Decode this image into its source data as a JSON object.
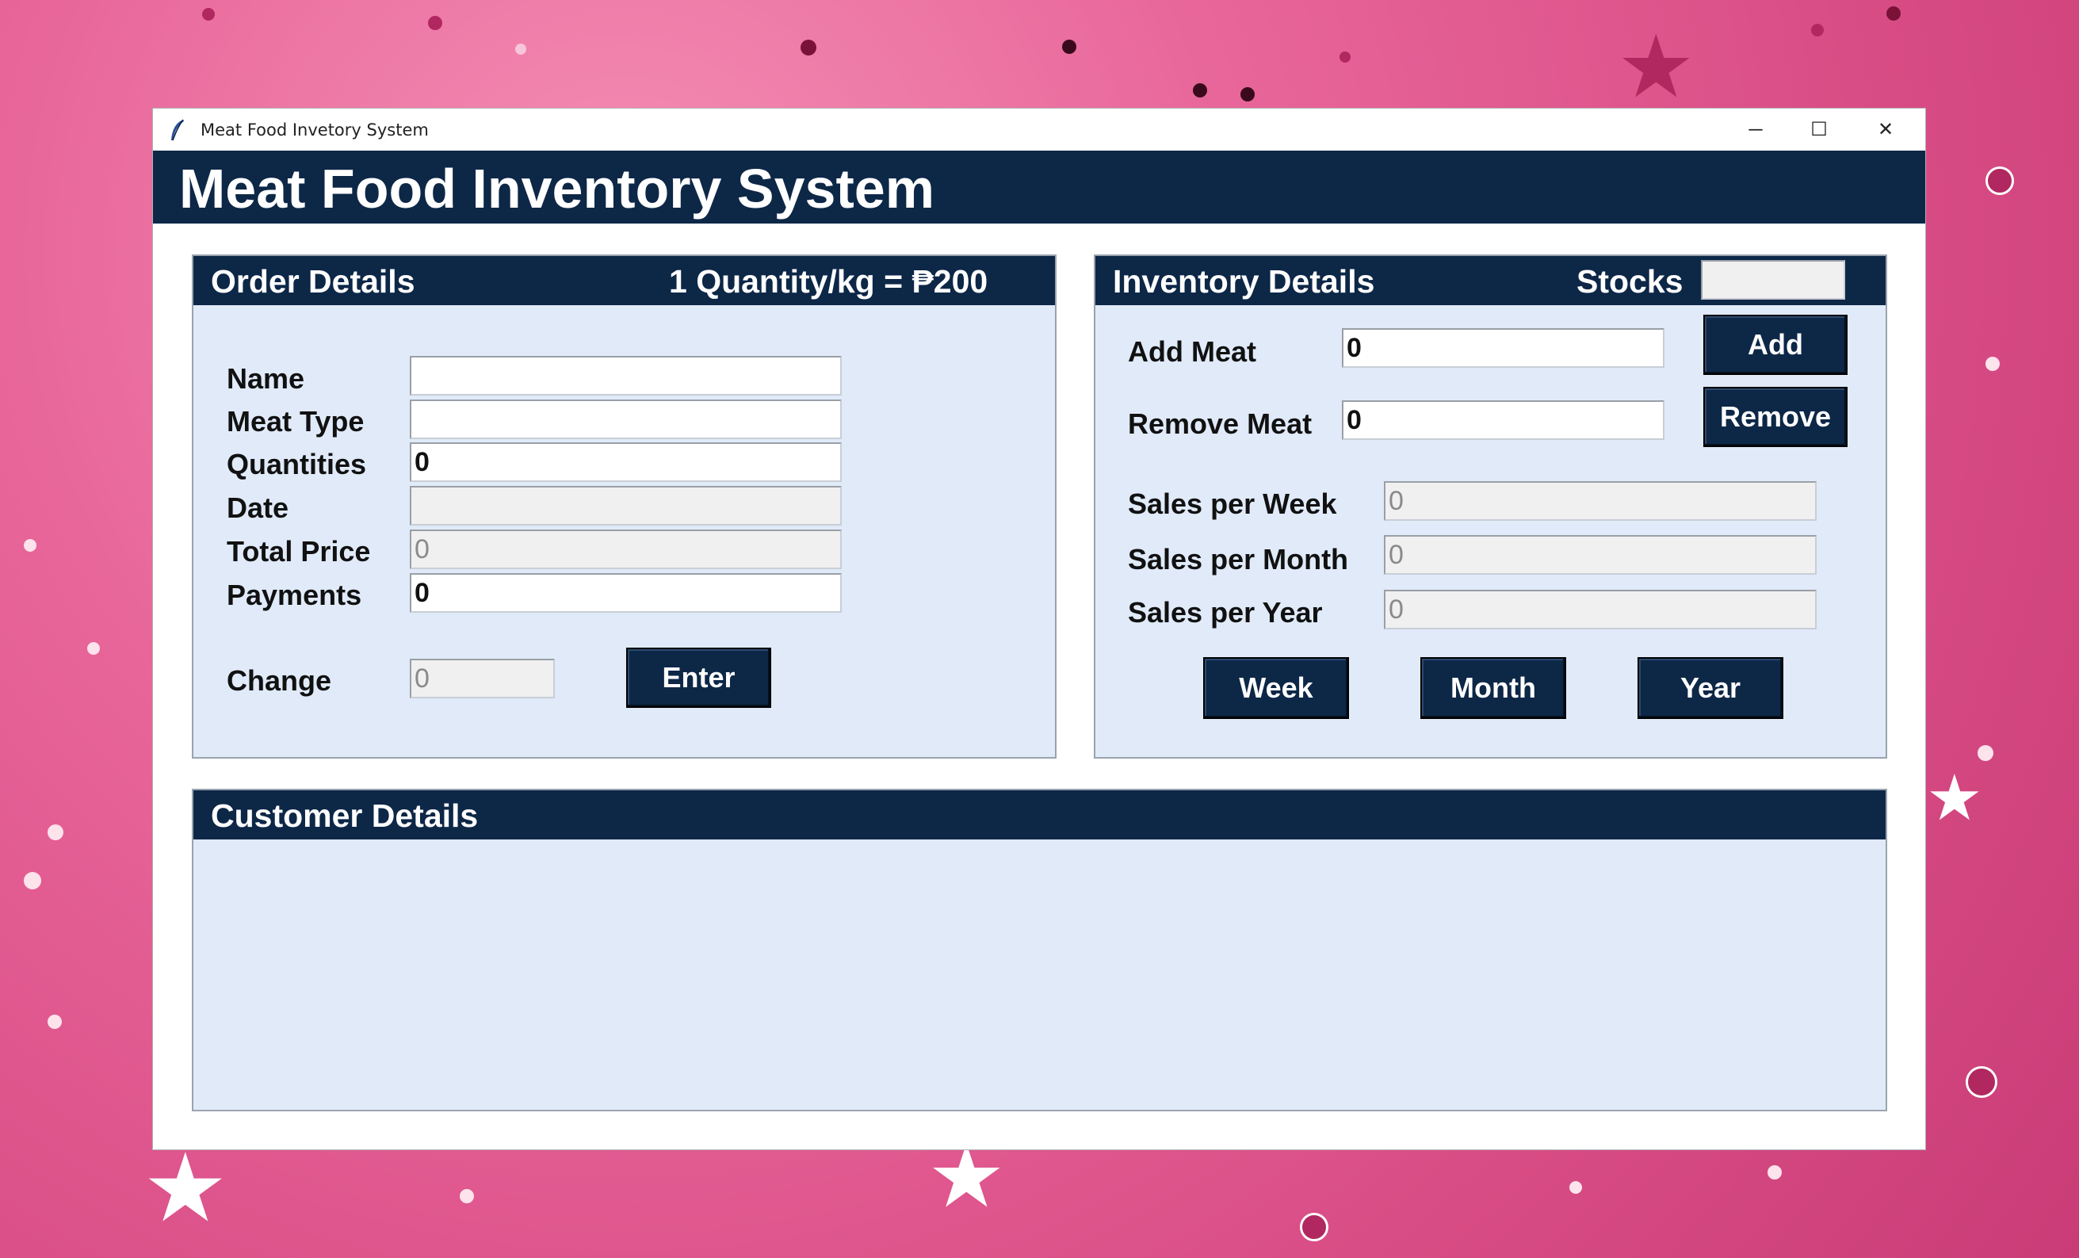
{
  "window": {
    "title": "Meat Food Invetory System",
    "app_icon": "feather-icon",
    "controls": {
      "minimize": "─",
      "maximize": "☐",
      "close": "✕"
    }
  },
  "header": {
    "title": "Meat Food Inventory System"
  },
  "order": {
    "title": "Order Details",
    "rate": "1 Quantity/kg = ₱200",
    "fields": {
      "name": {
        "label": "Name",
        "value": ""
      },
      "meat_type": {
        "label": "Meat Type",
        "value": ""
      },
      "quantities": {
        "label": "Quantities",
        "value": "0"
      },
      "date": {
        "label": "Date",
        "value": ""
      },
      "total_price": {
        "label": "Total Price",
        "value": "0"
      },
      "payments": {
        "label": "Payments",
        "value": "0"
      },
      "change": {
        "label": "Change",
        "value": "0"
      }
    },
    "enter_label": "Enter"
  },
  "inventory": {
    "title": "Inventory Details",
    "stocks_label": "Stocks",
    "stocks_value": "",
    "add_meat": {
      "label": "Add Meat",
      "value": "0"
    },
    "remove_meat": {
      "label": "Remove Meat",
      "value": "0"
    },
    "add_label": "Add",
    "remove_label": "Remove",
    "sales_week": {
      "label": "Sales per Week",
      "value": "0"
    },
    "sales_month": {
      "label": "Sales per Month",
      "value": "0"
    },
    "sales_year": {
      "label": "Sales per Year",
      "value": "0"
    },
    "week_label": "Week",
    "month_label": "Month",
    "year_label": "Year"
  },
  "customer": {
    "title": "Customer Details"
  },
  "colors": {
    "header_navy": "#0d2747",
    "panel_bg": "#e0eaf9",
    "background_pink": "#e8669a"
  }
}
